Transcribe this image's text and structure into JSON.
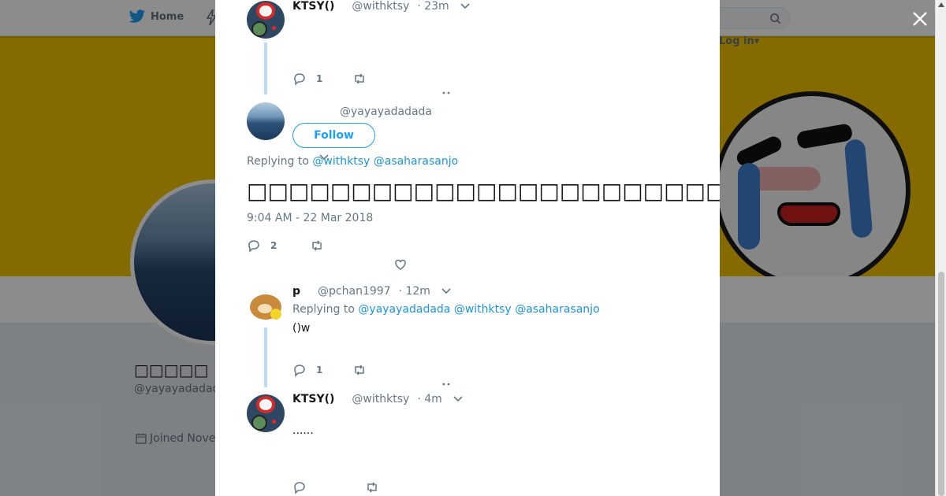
{
  "background": {
    "nav_home": "Home",
    "login": "Log in",
    "profile_name": "□□□□□",
    "profile_handle": "@yayayadadada",
    "joined": "Joined Nove"
  },
  "tweets": [
    {
      "name": "KTSY()",
      "handle": "@withktsy",
      "time": "· 23m",
      "reply_count": "1",
      "avatar": "ktsy-avatar"
    },
    {
      "handle": "@yayayadadada",
      "follow_label": "Follow",
      "replying_prefix": "Replying to",
      "replying_to": [
        "@withktsy",
        "@asaharasanjo"
      ],
      "text": "□□□□□□□□□□□□□□□□□□□□□□□□□□□□□□□□□□□□□□□□",
      "timestamp": "9:04 AM - 22 Mar 2018",
      "reply_count": "2"
    },
    {
      "name": "p",
      "handle": "@pchan1997",
      "time": "· 12m",
      "replying_prefix": "Replying to",
      "replying_to": [
        "@yayayadadada",
        "@withktsy",
        "@asaharasanjo"
      ],
      "text": "()w",
      "reply_count": "1"
    },
    {
      "name": "KTSY()",
      "handle": "@withktsy",
      "time": "· 4m",
      "text": "......",
      "reply_count": ""
    }
  ],
  "colors": {
    "link": "#1b95e0",
    "muted": "#657786",
    "banner": "#f2c200"
  }
}
